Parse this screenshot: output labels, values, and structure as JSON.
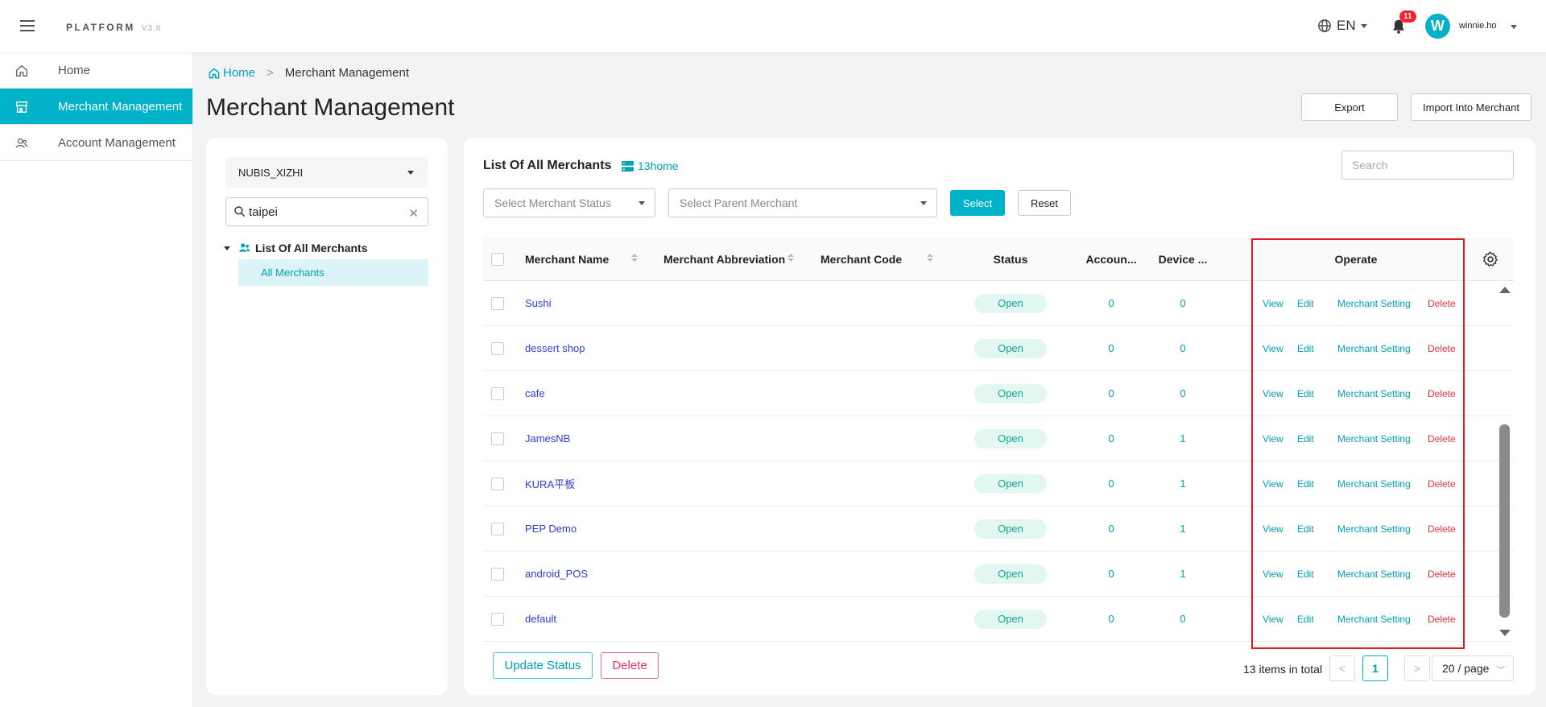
{
  "brand": {
    "name": "PLATFORM",
    "version": "V3.8"
  },
  "header": {
    "language": "EN",
    "notification_count": "11",
    "avatar_letter": "W",
    "username": "winnie.ho"
  },
  "sidebar": {
    "items": [
      {
        "label": "Home",
        "icon": "home-icon"
      },
      {
        "label": "Merchant Management",
        "icon": "store-icon",
        "active": true
      },
      {
        "label": "Account Management",
        "icon": "users-icon"
      }
    ]
  },
  "breadcrumb": {
    "home": "Home",
    "separator": ">",
    "current": "Merchant Management"
  },
  "page": {
    "title": "Merchant Management",
    "export_label": "Export",
    "import_label": "Import Into Merchant"
  },
  "tree": {
    "org_select": "NUBIS_XIZHI",
    "search_value": "taipei",
    "root_label": "List Of All Merchants",
    "child_label": "All Merchants"
  },
  "list": {
    "title": "List Of All Merchants",
    "store_label": "13home",
    "search_placeholder": "Search",
    "status_placeholder": "Select Merchant Status",
    "parent_placeholder": "Select Parent Merchant",
    "select_label": "Select",
    "reset_label": "Reset"
  },
  "table": {
    "columns": {
      "name": "Merchant Name",
      "abbr": "Merchant Abbreviation",
      "code": "Merchant Code",
      "status": "Status",
      "accounts": "Accoun...",
      "devices": "Device ...",
      "operate": "Operate"
    },
    "actions": {
      "view": "View",
      "edit": "Edit",
      "setting": "Merchant Setting",
      "delete": "Delete"
    },
    "rows": [
      {
        "name": "Sushi",
        "status": "Open",
        "accounts": "0",
        "devices": "0"
      },
      {
        "name": "dessert shop",
        "status": "Open",
        "accounts": "0",
        "devices": "0"
      },
      {
        "name": "cafe",
        "status": "Open",
        "accounts": "0",
        "devices": "0"
      },
      {
        "name": "JamesNB",
        "status": "Open",
        "accounts": "0",
        "devices": "1"
      },
      {
        "name": "KURA平板",
        "status": "Open",
        "accounts": "0",
        "devices": "1"
      },
      {
        "name": "PEP Demo",
        "status": "Open",
        "accounts": "0",
        "devices": "1"
      },
      {
        "name": "android_POS",
        "status": "Open",
        "accounts": "0",
        "devices": "1"
      },
      {
        "name": "default",
        "status": "Open",
        "accounts": "0",
        "devices": "0"
      }
    ]
  },
  "footer": {
    "update_status_label": "Update Status",
    "delete_label": "Delete",
    "total": "13 items in total",
    "prev": "<",
    "page": "1",
    "next": ">",
    "page_size": "20 / page"
  },
  "colors": {
    "accent": "#00b2c7",
    "danger": "#e5333f",
    "highlight_border": "#e01b22"
  }
}
